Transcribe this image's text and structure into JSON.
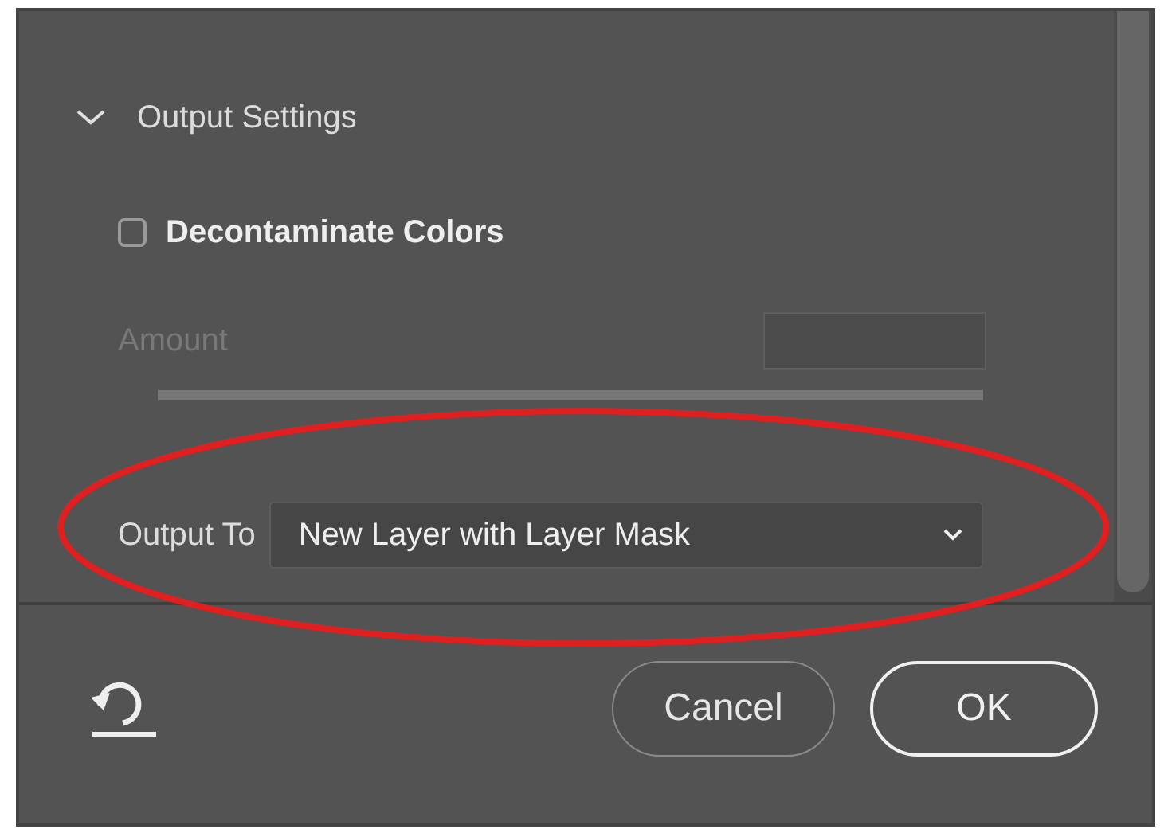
{
  "section": {
    "title": "Output Settings",
    "expanded": true
  },
  "decontaminate": {
    "label": "Decontaminate Colors",
    "checked": false
  },
  "amount": {
    "label": "Amount",
    "disabled": true
  },
  "output_to": {
    "label": "Output To",
    "value": "New Layer with Layer Mask"
  },
  "buttons": [
    {
      "label": "Cancel",
      "kind": "secondary"
    },
    {
      "label": "OK",
      "kind": "primary"
    }
  ],
  "annotation": {
    "kind": "ellipse",
    "color": "#e02020"
  }
}
